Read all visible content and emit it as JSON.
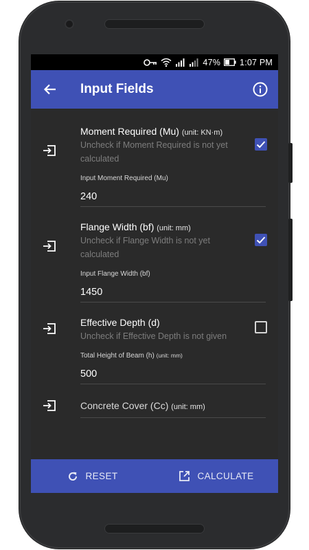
{
  "status_bar": {
    "battery_percent": "47%",
    "time": "1:07 PM",
    "icons": [
      "key-icon",
      "wifi-icon",
      "signal-icon",
      "signal-icon",
      "battery-icon"
    ]
  },
  "app_bar": {
    "title": "Input Fields",
    "back_icon": "arrow-back-icon",
    "info_icon": "info-icon",
    "accent_color": "#3f51b5"
  },
  "fields": [
    {
      "title": "Moment Required (Mu)",
      "unit": "(unit: KN·m)",
      "hint": "Uncheck if Moment Required is not yet calculated",
      "checked": true,
      "input_label": "Input Moment Required (Mu)",
      "value": "240"
    },
    {
      "title": "Flange Width (bf)",
      "unit": "(unit: mm)",
      "hint": "Uncheck if Flange Width is not yet calculated",
      "checked": true,
      "input_label": "Input Flange Width (bf)",
      "value": "1450"
    },
    {
      "title": "Effective Depth (d)",
      "unit": "",
      "hint": "Uncheck if Effective Depth is not given",
      "checked": false,
      "input_label": "Total Height of Beam (h)",
      "input_label_unit": "(unit: mm)",
      "value": "500"
    },
    {
      "title": "Concrete Cover (Cc)",
      "unit": "(unit: mm)"
    }
  ],
  "bottom_bar": {
    "reset_label": "RESET",
    "calculate_label": "CALCULATE"
  }
}
